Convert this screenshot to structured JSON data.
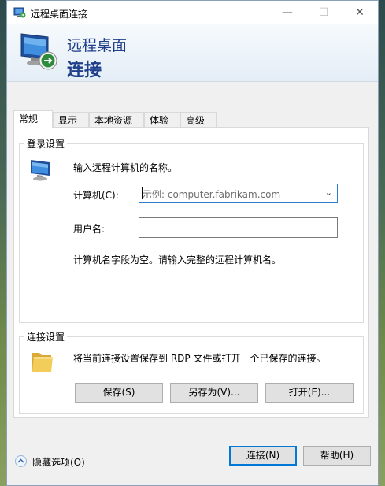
{
  "window": {
    "title": "远程桌面连接",
    "controls": {
      "minimize": "—",
      "maximize": "☐",
      "close": "✕"
    }
  },
  "header": {
    "line1": "远程桌面",
    "line2": "连接"
  },
  "tabs": [
    {
      "label": "常规",
      "active": true
    },
    {
      "label": "显示",
      "active": false
    },
    {
      "label": "本地资源",
      "active": false
    },
    {
      "label": "体验",
      "active": false
    },
    {
      "label": "高级",
      "active": false
    }
  ],
  "logon": {
    "group_title": "登录设置",
    "instruction": "输入远程计算机的名称。",
    "computer_label": "计算机(C):",
    "computer_placeholder": "示例: computer.fabrikam.com",
    "username_label": "用户名:",
    "username_value": "",
    "hint": "计算机名字段为空。请输入完整的远程计算机名。"
  },
  "connection": {
    "group_title": "连接设置",
    "description": "将当前连接设置保存到 RDP 文件或打开一个已保存的连接。",
    "save_button": "保存(S)",
    "save_as_button": "另存为(V)...",
    "open_button": "打开(E)..."
  },
  "footer": {
    "hide_options": "隐藏选项(O)",
    "connect_button": "连接(N)",
    "help_button": "帮助(H)"
  },
  "colors": {
    "accent": "#0078d7",
    "header_text": "#1e3f8a"
  }
}
